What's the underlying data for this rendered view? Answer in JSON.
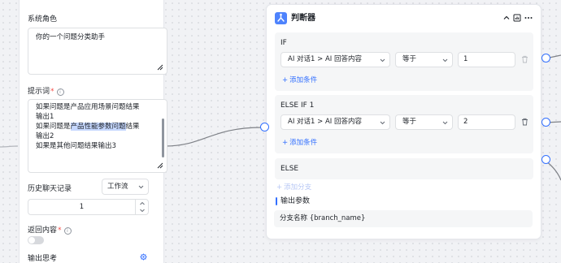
{
  "left_panel": {
    "system_role_label": "系统角色",
    "system_role_value": "你的一个问题分类助手",
    "prompt_label": "提示词",
    "prompt_required": "*",
    "prompt_lines": {
      "l1": "如果问题是产品应用场景问题结果",
      "l2": "输出1",
      "l3a": "如果问题是",
      "l3b": "产品性能参数问题",
      "l3c": "结果",
      "l4": "输出2",
      "l5": "如果是其他问题结果输出3"
    },
    "history_label": "历史聊天记录",
    "history_select": "工作流",
    "history_count": "1",
    "return_label": "返回内容",
    "return_required": "*",
    "output_thinking_label": "输出思考"
  },
  "condition_node": {
    "title": "判断器",
    "branches": [
      {
        "title": "IF",
        "variable": "AI 对话1 > AI 回答内容",
        "operator": "等于",
        "value": "1",
        "add_condition": "添加条件"
      },
      {
        "title": "ELSE IF 1",
        "variable": "AI 对话1 > AI 回答内容",
        "operator": "等于",
        "value": "2",
        "add_condition": "添加条件"
      },
      {
        "title": "ELSE"
      }
    ],
    "add_branch": "添加分支",
    "output_params_label": "输出参数",
    "output_param": "分支名称 {branch_name}"
  },
  "colors": {
    "accent": "#3370ff",
    "node_icon": "#4e83fd",
    "highlight": "#c6d8ff"
  },
  "icons": [
    "info-icon",
    "resize-icon",
    "chevron-down-icon",
    "trash-icon",
    "collapse-icon",
    "panel-icon",
    "more-icon",
    "gear-icon",
    "branch-node-icon"
  ]
}
